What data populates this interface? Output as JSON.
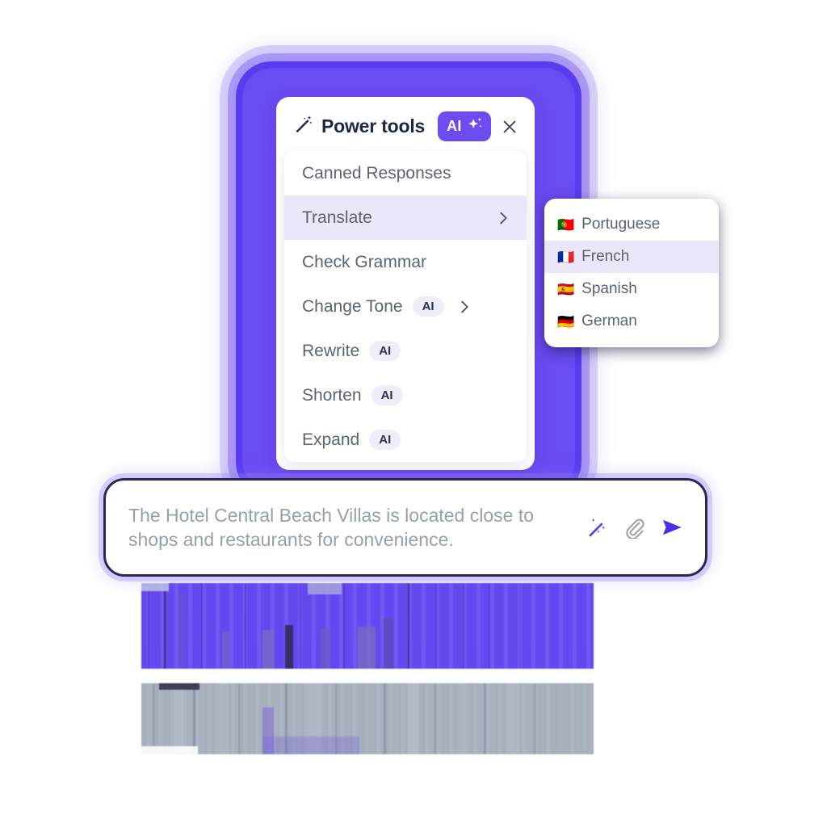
{
  "panel": {
    "title": "Power tools",
    "wand_icon": "magic-wand-icon",
    "ai_badge": {
      "label": "AI",
      "sparkle_icon": "sparkle-icon",
      "color": "#6C4BF0"
    },
    "close_icon": "close-icon",
    "items": [
      {
        "label": "Canned Responses",
        "ai": false,
        "chevron": false,
        "selected": false
      },
      {
        "label": "Translate",
        "ai": false,
        "chevron": true,
        "selected": true
      },
      {
        "label": "Check Grammar",
        "ai": false,
        "chevron": false,
        "selected": false
      },
      {
        "label": "Change Tone",
        "ai": true,
        "chevron": true,
        "selected": false
      },
      {
        "label": "Rewrite",
        "ai": true,
        "chevron": false,
        "selected": false
      },
      {
        "label": "Shorten",
        "ai": true,
        "chevron": false,
        "selected": false
      },
      {
        "label": "Expand",
        "ai": true,
        "chevron": false,
        "selected": false
      }
    ],
    "ai_chip_label": "AI"
  },
  "language_submenu": {
    "items": [
      {
        "flag": "🇵🇹",
        "label": "Portuguese",
        "selected": false
      },
      {
        "flag": "🇫🇷",
        "label": "French",
        "selected": true
      },
      {
        "flag": "🇪🇸",
        "label": "Spanish",
        "selected": false
      },
      {
        "flag": "🇩🇪",
        "label": "German",
        "selected": false
      }
    ]
  },
  "message_bar": {
    "text": "The Hotel Central Beach Villas is located close to shops and restaurants for convenience.",
    "actions": [
      {
        "name": "magic-wand-icon",
        "color": "#5B3BEE"
      },
      {
        "name": "attachment-icon",
        "color": "#9AA3AC"
      },
      {
        "name": "send-icon",
        "color": "#4B2EE6"
      }
    ]
  },
  "bottom_text": {
    "heading": "",
    "body": "",
    "note": "illegible corrupted render"
  },
  "colors": {
    "frame_purple": "#5B3BEE",
    "accent": "#6C4BF0",
    "selected_row": "#EBE6FA",
    "chip_bg": "#F0EDFA",
    "text_muted": "#5A6470",
    "title_dark": "#1F2547"
  }
}
